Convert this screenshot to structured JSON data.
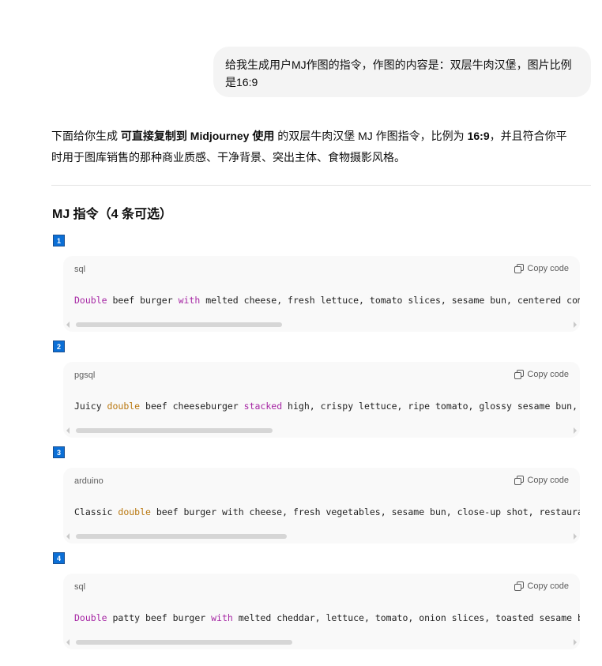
{
  "user_message": {
    "line1": "给我生成用户MJ作图的指令，作图的内容是：双层牛肉汉堡，图片比例",
    "line2": "是16:9"
  },
  "intro": {
    "part1": "下面给你生成 ",
    "bold1": "可直接复制到 Midjourney 使用",
    "part2": " 的双层牛肉汉堡 MJ 作图指令，比例为 ",
    "bold2": "16:9",
    "part3": "，并且符合你平",
    "line2": "时用于图库销售的那种商业质感、干净背景、突出主体、食物摄影风格。"
  },
  "section_title": "MJ 指令（4 条可选）",
  "copy_label": "Copy code",
  "blocks": [
    {
      "number": "1",
      "lang": "sql",
      "kw1": "Double",
      "t1": " beef burger ",
      "kw2": "with",
      "t2": " melted cheese, fresh lettuce, tomato slices, sesame bun, centered comp",
      "scroll_fraction": 0.42
    },
    {
      "number": "2",
      "lang": "pgsql",
      "t0": "Juicy ",
      "kw1": "double",
      "t1": " beef cheeseburger ",
      "kw2": "stacked",
      "t2": " high, crispy lettuce, ripe tomato, glossy sesame bun, i",
      "scroll_fraction": 0.4
    },
    {
      "number": "3",
      "lang": "arduino",
      "t0": "Classic ",
      "kw1": "double",
      "t1": " beef burger with cheese, fresh vegetables, sesame bun, close-up shot, restaurar",
      "scroll_fraction": 0.43
    },
    {
      "number": "4",
      "lang": "sql",
      "kw1": "Double",
      "t1": " patty beef burger ",
      "kw2": "with",
      "t2": " melted cheddar, lettuce, tomato, onion slices, toasted sesame bu",
      "scroll_fraction": 0.44
    }
  ]
}
